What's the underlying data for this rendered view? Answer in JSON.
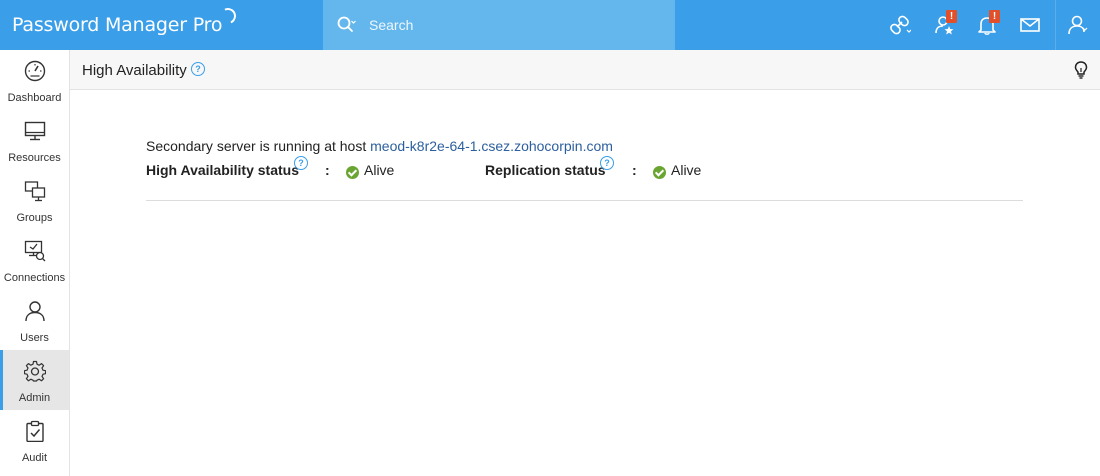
{
  "app": {
    "title": "Password Manager Pro"
  },
  "search": {
    "placeholder": "Search"
  },
  "header_icons": [
    {
      "icon": "link-dropdown-icon"
    },
    {
      "icon": "star-user-icon",
      "badge": "!"
    },
    {
      "icon": "bell-icon",
      "badge": "!"
    },
    {
      "icon": "mail-icon"
    },
    {
      "icon": "user-menu-icon"
    }
  ],
  "sidebar": {
    "items": [
      {
        "label": "Dashboard",
        "icon": "dashboard-gauge-icon"
      },
      {
        "label": "Resources",
        "icon": "monitor-icon"
      },
      {
        "label": "Groups",
        "icon": "groups-monitors-icon"
      },
      {
        "label": "Connections",
        "icon": "connections-icon"
      },
      {
        "label": "Users",
        "icon": "user-icon"
      },
      {
        "label": "Admin",
        "icon": "gear-icon",
        "active": true
      },
      {
        "label": "Audit",
        "icon": "clipboard-check-icon"
      }
    ]
  },
  "page": {
    "title": "High Availability",
    "help": "?"
  },
  "main": {
    "host_prefix": "Secondary server is running at host ",
    "host": "meod-k8r2e-64-1.csez.zohocorpin.com",
    "ha_label": "High Availability status",
    "ha_help": "?",
    "ha_colon": ":",
    "ha_value": "Alive",
    "rep_label": "Replication status",
    "rep_help": "?",
    "rep_colon": ":",
    "rep_value": "Alive"
  },
  "colors": {
    "header_blue": "#3a9ee8",
    "search_blue": "#64b7ec",
    "badge_orange": "#e2502b",
    "status_green": "#6aa531",
    "link_blue": "#2c5f9e"
  }
}
